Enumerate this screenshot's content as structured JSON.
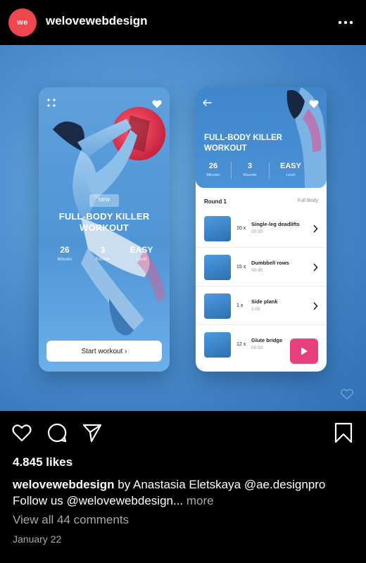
{
  "header": {
    "avatar_text": "we",
    "username": "welovewebdesign"
  },
  "post": {
    "phone1": {
      "badge": "NEW",
      "title_line1": "FULL-BODY KILLER",
      "title_line2": "WORKOUT",
      "stats": [
        {
          "value": "26",
          "label": "Minutes"
        },
        {
          "value": "3",
          "label": "Rounds"
        },
        {
          "value": "EASY",
          "label": "Level"
        }
      ],
      "start_label": "Start workout ›"
    },
    "phone2": {
      "title_line1": "FULL-BODY KILLER",
      "title_line2": "WORKOUT",
      "stats": [
        {
          "value": "26",
          "label": "Minutes"
        },
        {
          "value": "3",
          "label": "Rounds"
        },
        {
          "value": "EASY",
          "label": "Level"
        }
      ],
      "round_label": "Round 1",
      "type_label": "Full Body",
      "exercises": [
        {
          "reps": "10 x",
          "name": "Single-leg deadlifts",
          "time": "00:30"
        },
        {
          "reps": "15 x",
          "name": "Dumbbell rows",
          "time": "00:45"
        },
        {
          "reps": "1 x",
          "name": "Side plank",
          "time": "1:00"
        },
        {
          "reps": "12 x",
          "name": "Glute bridge",
          "time": "00:50"
        }
      ]
    }
  },
  "likes": "4.845 likes",
  "caption": {
    "author": "welovewebdesign",
    "text": " by Anastasia Eletskaya @ae.designpro",
    "line2": "Follow us @welovewebdesign...",
    "more": " more"
  },
  "comments_link": "View all 44 comments",
  "date": "January 22",
  "colors": {
    "brand_red": "#f0474f",
    "accent_pink": "#e83f7e",
    "post_blue": "#4d8fd0"
  }
}
